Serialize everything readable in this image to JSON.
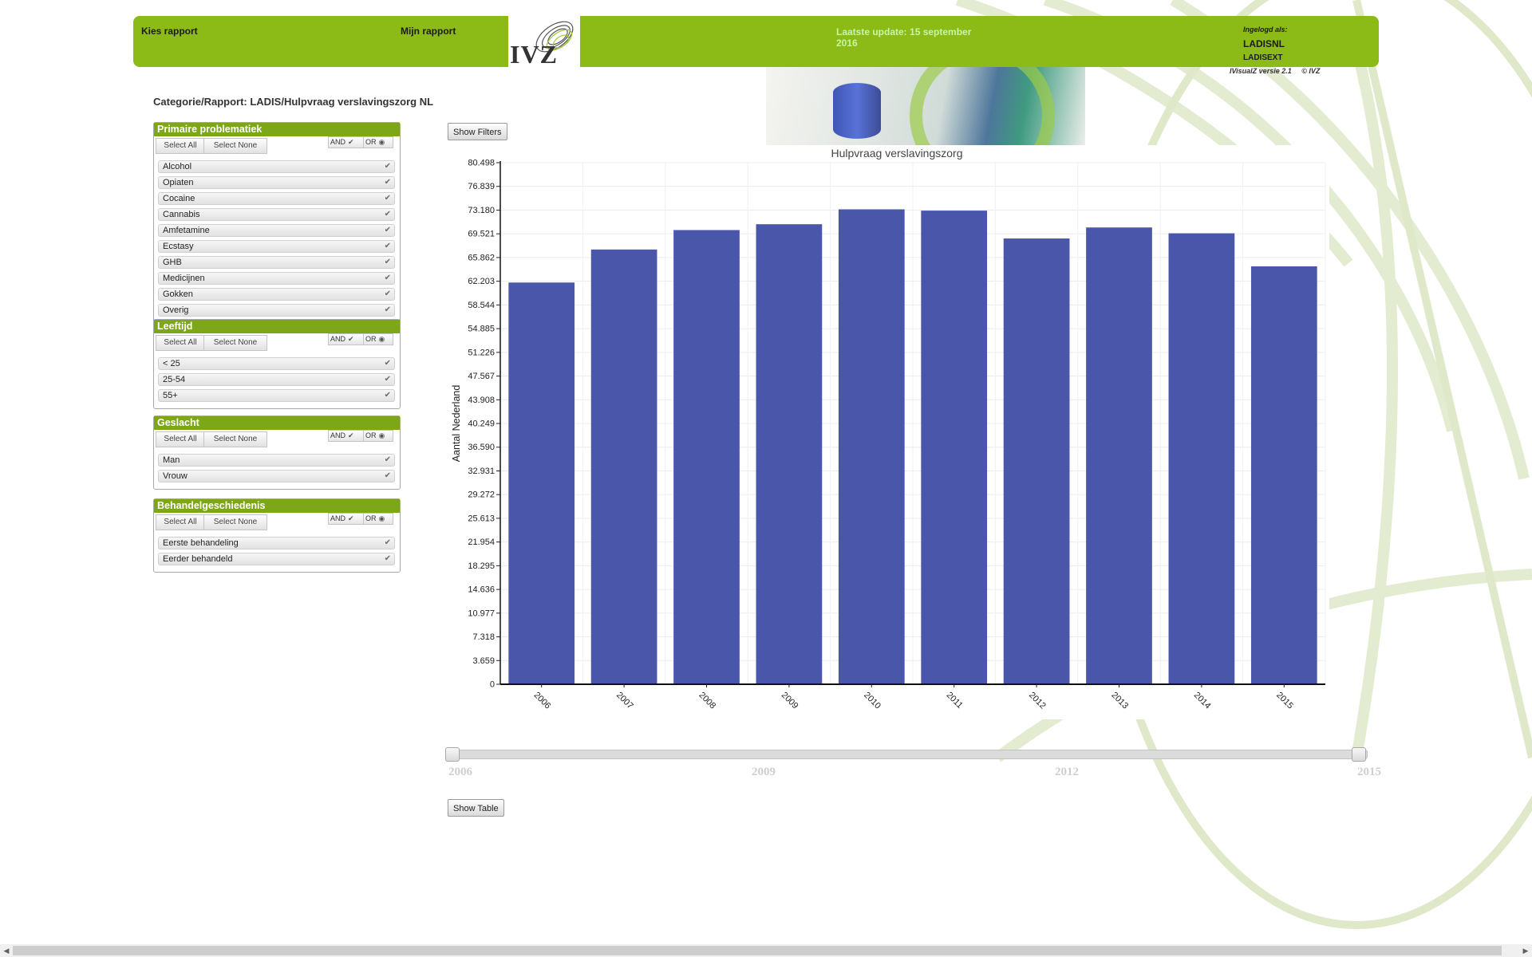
{
  "header": {
    "nav_kies": "Kies rapport",
    "nav_mijn": "Mijn rapport",
    "logo_text": "IVZ",
    "update_text": "Laatste update: 15 september 2016",
    "login_label": "Ingelogd als:",
    "login_user": "LADISNL",
    "login_user2": "LADISEXT",
    "version": "IVisualZ versie 2.1     © IVZ"
  },
  "breadcrumb": "Categorie/Rapport: LADIS/Hulpvraag verslavingszorg NL",
  "common": {
    "select_all": "Select All",
    "select_none": "Select None",
    "and": "AND",
    "or": "OR"
  },
  "filters": {
    "primaire": {
      "title": "Primaire problematiek",
      "items": [
        "Alcohol",
        "Opiaten",
        "Cocaine",
        "Cannabis",
        "Amfetamine",
        "Ecstasy",
        "GHB",
        "Medicijnen",
        "Gokken",
        "Overig"
      ]
    },
    "leeftijd": {
      "title": "Leeftijd",
      "items": [
        "< 25",
        "25-54",
        "55+"
      ]
    },
    "geslacht": {
      "title": "Geslacht",
      "items": [
        "Man",
        "Vrouw"
      ]
    },
    "behandel": {
      "title": "Behandelgeschiedenis",
      "items": [
        "Eerste behandeling",
        "Eerder behandeld"
      ]
    }
  },
  "buttons": {
    "show_filters": "Show Filters",
    "show_table": "Show Table"
  },
  "slider": {
    "labels": [
      "2006",
      "2009",
      "2012",
      "2015"
    ],
    "range": [
      "2006",
      "2015"
    ]
  },
  "colors": {
    "header_green": "#8cba16",
    "panel_green": "#7ea619",
    "bar_color": "#4a56aa",
    "update_text": "#c8f5a6"
  },
  "chart_data": {
    "type": "bar",
    "title": "Hulpvraag verslavingszorg",
    "xlabel": "",
    "ylabel": "Aantal Nederland",
    "categories": [
      "2006",
      "2007",
      "2008",
      "2009",
      "2010",
      "2011",
      "2012",
      "2013",
      "2014",
      "2015"
    ],
    "values": [
      62000,
      67100,
      70100,
      71000,
      73300,
      73100,
      68800,
      70500,
      69600,
      64500
    ],
    "ylim": [
      0,
      80498
    ],
    "yticks": [
      "0",
      "3.659",
      "7.318",
      "10.977",
      "14.636",
      "18.295",
      "21.954",
      "25.613",
      "29.272",
      "32.931",
      "36.590",
      "40.249",
      "43.908",
      "47.567",
      "51.226",
      "54.885",
      "58.544",
      "62.203",
      "65.862",
      "69.521",
      "73.180",
      "76.839",
      "80.498"
    ],
    "grid": true
  }
}
